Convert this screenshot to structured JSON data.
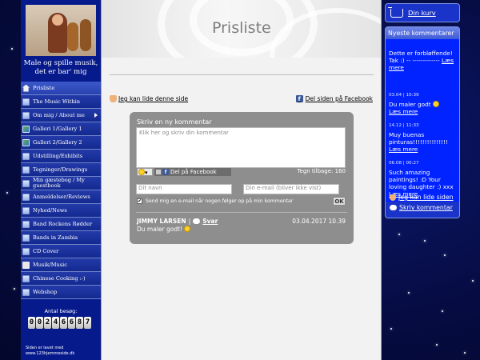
{
  "sidebar": {
    "tagline": "Male og spille musik, det er bar' mig",
    "items": [
      {
        "label": "Prisliste",
        "icon": "home-icon",
        "active": true
      },
      {
        "label": "The Music Within",
        "icon": "page-icon"
      },
      {
        "label": "Om mig / About me",
        "icon": "page-icon",
        "has_submenu": true
      },
      {
        "label": "Galleri 1/Gallery 1",
        "icon": "gallery-icon"
      },
      {
        "label": "Galleri 2/Gallery 2",
        "icon": "gallery-icon"
      },
      {
        "label": "Udstilling/Exhibits",
        "icon": "page-icon"
      },
      {
        "label": "Tegninger/Drawings",
        "icon": "page-icon"
      },
      {
        "label": "Min gæstebog / My guestbook",
        "icon": "page-icon"
      },
      {
        "label": "Anmeldelser/Reviews",
        "icon": "page-icon"
      },
      {
        "label": "Nyhed/News",
        "icon": "page-icon"
      },
      {
        "label": "Band Rockens Rødder",
        "icon": "page-icon"
      },
      {
        "label": "Bands in Zambia",
        "icon": "page-icon"
      },
      {
        "label": "CD Cover",
        "icon": "page-icon"
      },
      {
        "label": "Musik/Music",
        "icon": "music-icon"
      },
      {
        "label": "Chinese Cooking :-)",
        "icon": "page-icon"
      },
      {
        "label": "Webshop",
        "icon": "page-icon"
      }
    ],
    "counter_label": "Antal besøg:",
    "counter_digits": [
      "0",
      "0",
      "2",
      "4",
      "6",
      "6",
      "8",
      "7"
    ],
    "made_with": "Siden er lavet med",
    "made_with_site": "www.123hjemmeside.dk"
  },
  "main": {
    "page_title": "Prisliste",
    "like_link": "Jeg kan lide denne side",
    "share_link": "Del siden på Facebook",
    "comment_form": {
      "title": "Skriv en ny kommentar",
      "textarea_placeholder": "Klik her og skriv din kommentar",
      "facebook_button": "Del på Facebook",
      "chars_left": "Tegn tilbage: 160",
      "name_placeholder": "Dit navn",
      "email_placeholder": "Din e-mail (bliver ikke vist)",
      "notify_label": "Send mig en e-mail når nogen følger op på min kommentar",
      "notify_checked": true,
      "ok_label": "OK"
    },
    "comment": {
      "author": "JIMMY LARSEN",
      "separator": "|",
      "reply": "Svar",
      "date": "03.04.2017 10.39",
      "text": "Du maler godt!"
    }
  },
  "right": {
    "cart_label": "Din kurv",
    "comments_title": "Nyeste kommentarer",
    "more_label": "Læs mere",
    "comments": [
      {
        "date": "",
        "text": "Dette er forbløffende! Tak :) -- -------------"
      },
      {
        "date": "03.04 | 10:39",
        "text": "Du maler godt"
      },
      {
        "date": "14.12 | 11:33",
        "text": "Muy buenas pinturas!!!!!!!!!!!!!!!"
      },
      {
        "date": "06.08 | 00:27",
        "text": "Such amazing paintings! :D Your loving daughter :) xxx"
      }
    ],
    "like_link": "Jeg kan lide siden",
    "write_link": "Skriv kommentar"
  },
  "colors": {
    "sidebar_bg": "#061a8c",
    "comments_body": "#0023ff",
    "comment_form_bg": "#8e8e8e",
    "page_bg": "#060c44"
  }
}
